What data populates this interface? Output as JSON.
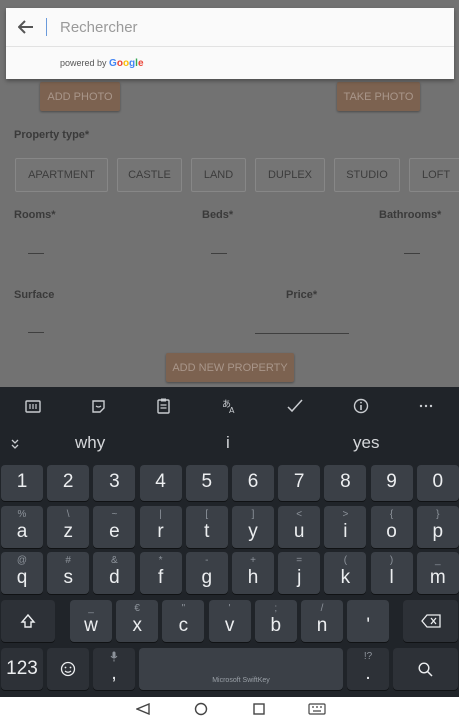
{
  "search": {
    "placeholder": "Rechercher",
    "powered_prefix": "powered by",
    "google": [
      "G",
      "o",
      "o",
      "g",
      "l",
      "e"
    ],
    "google_colors": [
      "#4285F4",
      "#EA4335",
      "#FBBC05",
      "#4285F4",
      "#34A853",
      "#EA4335"
    ]
  },
  "app": {
    "add_photo": "ADD PHOTO",
    "take_photo": "TAKE PHOTO",
    "property_type_label": "Property type*",
    "property_types": [
      "APARTMENT",
      "CASTLE",
      "LAND",
      "DUPLEX",
      "STUDIO",
      "LOFT"
    ],
    "rooms_label": "Rooms*",
    "beds_label": "Beds*",
    "bathrooms_label": "Bathrooms*",
    "surface_label": "Surface",
    "price_label": "Price*",
    "add_button": "ADD NEW PROPERTY"
  },
  "keyboard": {
    "suggestions": [
      "why",
      "i",
      "yes"
    ],
    "numbers": [
      "1",
      "2",
      "3",
      "4",
      "5",
      "6",
      "7",
      "8",
      "9",
      "0"
    ],
    "row1": [
      [
        "%",
        "a"
      ],
      [
        "\\",
        "z"
      ],
      [
        "~",
        "e"
      ],
      [
        "|",
        "r"
      ],
      [
        "[",
        "t"
      ],
      [
        "]",
        "y"
      ],
      [
        "<",
        "u"
      ],
      [
        ">",
        "i"
      ],
      [
        "{",
        "o"
      ],
      [
        "}",
        "p"
      ]
    ],
    "row2": [
      [
        "@",
        "q"
      ],
      [
        "#",
        "s"
      ],
      [
        "&",
        "d"
      ],
      [
        "*",
        "f"
      ],
      [
        "-",
        "g"
      ],
      [
        "+",
        "h"
      ],
      [
        "=",
        "j"
      ],
      [
        "(",
        "k"
      ],
      [
        ")",
        "l"
      ],
      [
        "_",
        "m"
      ]
    ],
    "row3": [
      [
        "_",
        "w"
      ],
      [
        "€",
        "x"
      ],
      [
        "\"",
        "c"
      ],
      [
        "'",
        "v"
      ],
      [
        ";",
        "b"
      ],
      [
        "/",
        "n"
      ],
      [
        "",
        "'"
      ]
    ],
    "num_toggle": "123",
    "comma": ",",
    "period": ".",
    "period_alt": "!?",
    "space_label": "Microsoft SwiftKey"
  },
  "colors": {
    "accent_brown": "#7c6250",
    "keyboard_bg": "#202429",
    "key_bg": "#3b4047"
  }
}
